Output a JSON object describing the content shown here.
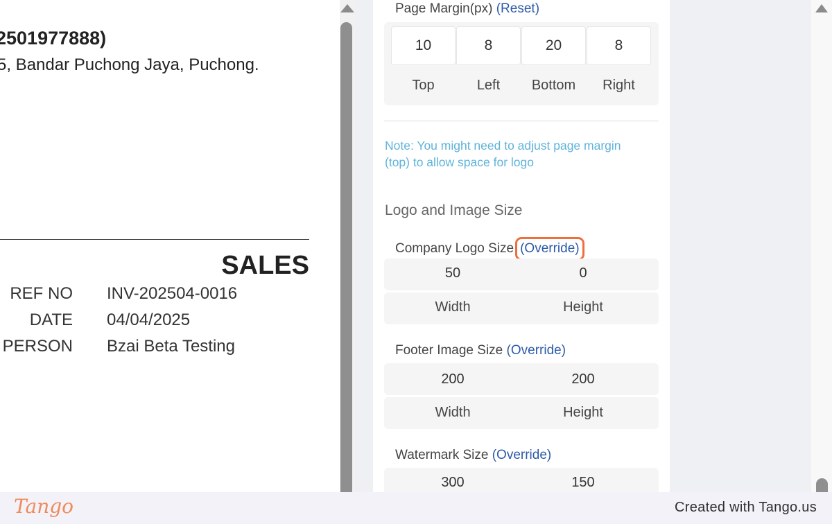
{
  "invoice": {
    "company_name": "2501977888)",
    "company_address": "5, Bandar Puchong Jaya, Puchong.",
    "doc_title": "SALES",
    "meta": [
      {
        "label": "REF NO",
        "value": "INV-202504-0016"
      },
      {
        "label": "DATE",
        "value": "04/04/2025"
      },
      {
        "label": "PERSON",
        "value": "Bzai Beta Testing"
      }
    ]
  },
  "settings": {
    "page_margin": {
      "label": "Page Margin(px)",
      "reset_label": "(Reset)",
      "values": {
        "top": "10",
        "left": "8",
        "bottom": "20",
        "right": "8"
      },
      "captions": {
        "top": "Top",
        "left": "Left",
        "bottom": "Bottom",
        "right": "Right"
      }
    },
    "note": "Note: You might need to adjust page margin (top) to allow space for logo",
    "logo_section_title": "Logo and Image Size",
    "company_logo": {
      "label": "Company Logo Size",
      "override_label": "(Override)",
      "width": "50",
      "height": "0",
      "width_caption": "Width",
      "height_caption": "Height"
    },
    "footer_image": {
      "label": "Footer Image Size",
      "override_label": "(Override)",
      "width": "200",
      "height": "200",
      "width_caption": "Width",
      "height_caption": "Height"
    },
    "watermark": {
      "label": "Watermark Size",
      "override_label": "(Override)",
      "width": "300",
      "height": "150"
    }
  },
  "footer": {
    "logo_text": "Tango",
    "credit": "Created with Tango.us"
  },
  "colors": {
    "link": "#2c5aa8",
    "note": "#5fb3d9",
    "highlight": "#ee6f3c",
    "tango_brand": "#ef8a5a"
  }
}
